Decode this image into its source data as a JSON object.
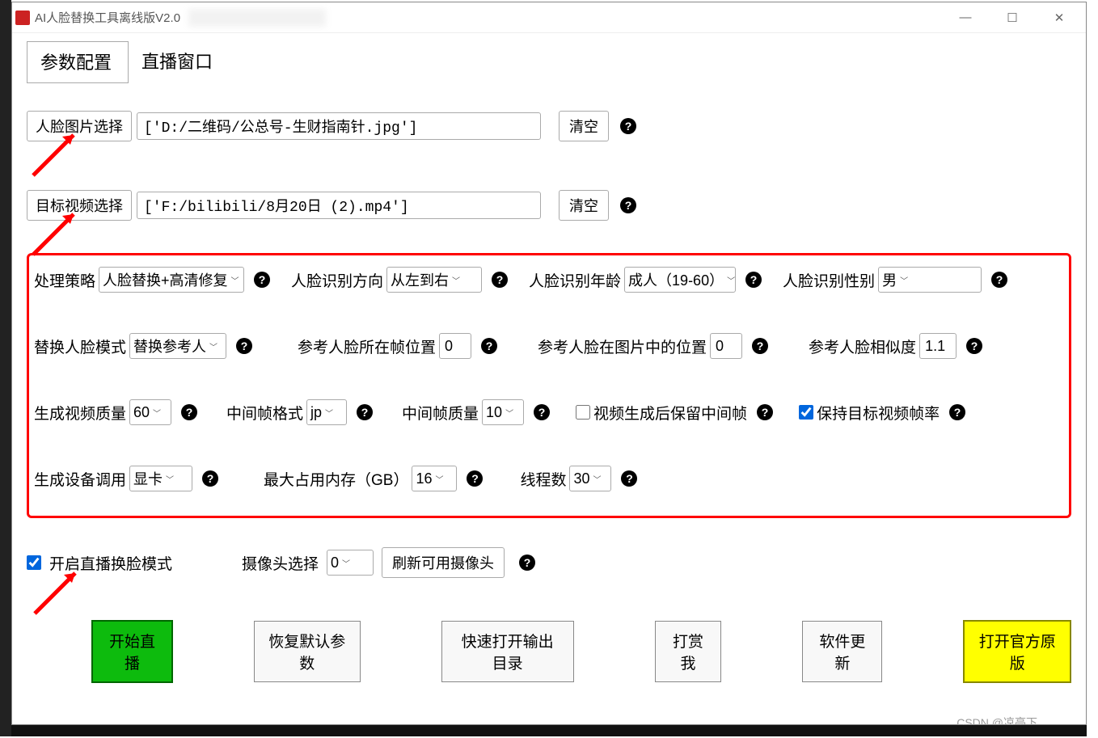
{
  "window": {
    "title": "AI人脸替换工具离线版V2.0"
  },
  "tabs": {
    "config": "参数配置",
    "live": "直播窗口"
  },
  "files": {
    "face_select_btn": "人脸图片选择",
    "face_path": "['D:/二维码/公总号-生财指南针.jpg']",
    "face_clear": "清空",
    "video_select_btn": "目标视频选择",
    "video_path": "['F:/bilibili/8月20日 (2).mp4']",
    "video_clear": "清空"
  },
  "params": {
    "strategy_label": "处理策略",
    "strategy_value": "人脸替换+高清修复",
    "direction_label": "人脸识别方向",
    "direction_value": "从左到右",
    "age_label": "人脸识别年龄",
    "age_value": "成人（19-60）",
    "gender_label": "人脸识别性别",
    "gender_value": "男",
    "replace_mode_label": "替换人脸模式",
    "replace_mode_value": "替换参考人",
    "ref_frame_pos_label": "参考人脸所在帧位置",
    "ref_frame_pos_value": "0",
    "ref_img_pos_label": "参考人脸在图片中的位置",
    "ref_img_pos_value": "0",
    "similarity_label": "参考人脸相似度",
    "similarity_value": "1.1",
    "video_quality_label": "生成视频质量",
    "video_quality_value": "60",
    "mid_format_label": "中间帧格式",
    "mid_format_value": "jp",
    "mid_quality_label": "中间帧质量",
    "mid_quality_value": "10",
    "keep_mid_label": "视频生成后保留中间帧",
    "keep_fps_label": "保持目标视频帧率",
    "device_label": "生成设备调用",
    "device_value": "显卡",
    "max_mem_label": "最大占用内存（GB）",
    "max_mem_value": "16",
    "threads_label": "线程数",
    "threads_value": "30"
  },
  "live": {
    "enable_label": "开启直播换脸模式",
    "camera_label": "摄像头选择",
    "camera_value": "0",
    "refresh_btn": "刷新可用摄像头"
  },
  "actions": {
    "start": "开始直播",
    "reset": "恢复默认参数",
    "open_output": "快速打开输出目录",
    "donate": "打赏我",
    "update": "软件更新",
    "open_official": "打开官方原版"
  },
  "watermark": "CSDN @凉亭下"
}
